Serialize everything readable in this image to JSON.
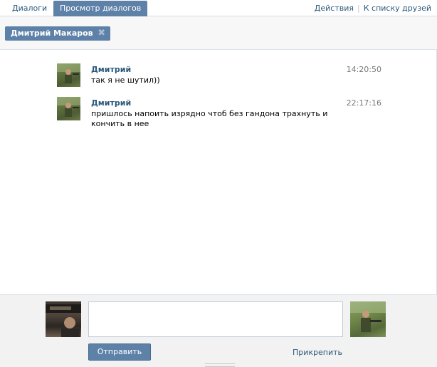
{
  "tabs": [
    {
      "label": "Диалоги"
    },
    {
      "label": "Просмотр диалогов",
      "active": true
    }
  ],
  "top_links": {
    "actions": "Действия",
    "separator": "|",
    "friends": "К списку друзей"
  },
  "recipient": {
    "name": "Дмитрий Макаров",
    "remove_symbol": "✖"
  },
  "messages": [
    {
      "author": "Дмитрий",
      "time": "14:20:50",
      "text": "так я не шутил))"
    },
    {
      "author": "Дмитрий",
      "time": "22:17:16",
      "text": "пришлось напоить изрядно чтоб без гандона трахнуть и кончить в нее"
    }
  ],
  "composer": {
    "value": "",
    "send_label": "Отправить",
    "attach_label": "Прикрепить"
  },
  "colors": {
    "accent": "#5e81a8",
    "link": "#2b587a",
    "composer_bg": "#f2f2f2"
  }
}
